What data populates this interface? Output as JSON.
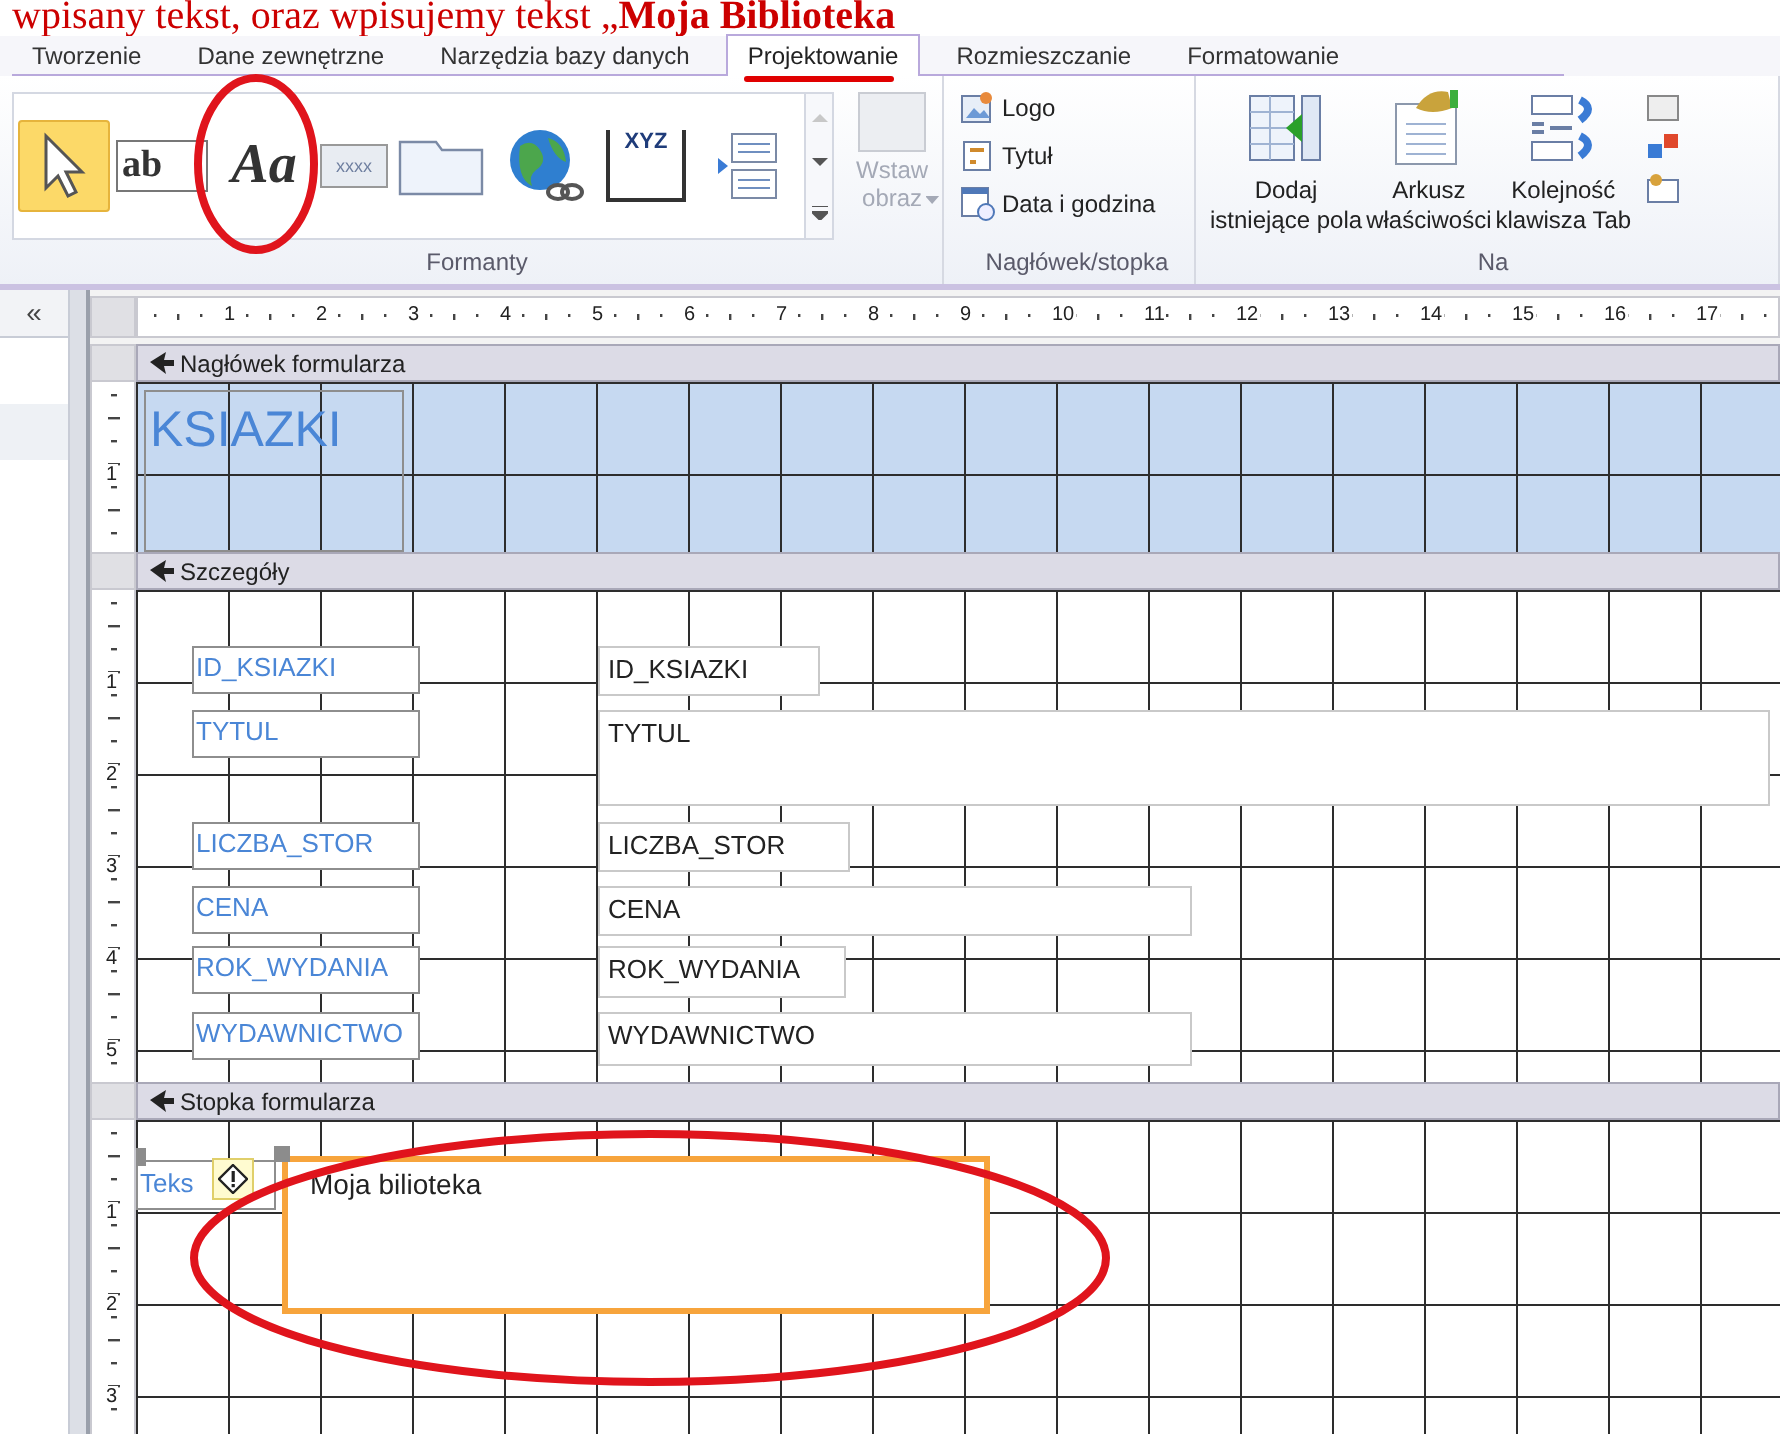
{
  "annotation": "wpisany tekst, oraz wpisujemy tekst „**Moja Biblioteka**",
  "tabs": [
    {
      "label": "Tworzenie",
      "selected": false
    },
    {
      "label": "Dane zewnętrzne",
      "selected": false
    },
    {
      "label": "Narzędzia bazy danych",
      "selected": false
    },
    {
      "label": "Projektowanie",
      "selected": true
    },
    {
      "label": "Rozmieszczanie",
      "selected": false
    },
    {
      "label": "Formatowanie",
      "selected": false
    }
  ],
  "ribbon": {
    "controls_group": {
      "label": "Formanty",
      "gallery": [
        {
          "kind": "pointer",
          "selected": true
        },
        {
          "kind": "textbox",
          "text": "ab"
        },
        {
          "kind": "label",
          "text": "Aa"
        },
        {
          "kind": "button",
          "text": "xxxx"
        },
        {
          "kind": "tab"
        },
        {
          "kind": "hyperlink"
        },
        {
          "kind": "option-group",
          "text": "XYZ"
        },
        {
          "kind": "list"
        }
      ],
      "insert_image": {
        "label": "Wstaw obraz",
        "disabled": true
      }
    },
    "header_group": {
      "label": "Nagłówek/stopka",
      "items": [
        {
          "kind": "logo",
          "label": "Logo"
        },
        {
          "kind": "title",
          "label": "Tytuł"
        },
        {
          "kind": "date",
          "label": "Data i godzina"
        }
      ]
    },
    "tools_group": {
      "label": "Na",
      "items": [
        {
          "kind": "fields",
          "line_1": "Dodaj",
          "line_2": "istniejące pola"
        },
        {
          "kind": "sheet",
          "line_1": "Arkusz",
          "line_2": "właściwości"
        },
        {
          "kind": "order",
          "line_1": "Kolejność",
          "line_2": "klawisza Tab"
        }
      ]
    }
  },
  "nav_pane": {
    "toggle": "«"
  },
  "ruler": {
    "marks": [
      "1",
      "2",
      "3",
      "4",
      "5",
      "6",
      "7",
      "8",
      "9",
      "10",
      "11",
      "12",
      "13",
      "14",
      "15",
      "16",
      "17"
    ]
  },
  "sections": [
    {
      "kind": "header",
      "title": "Nagłówek formularza",
      "ruler_marks": [
        "1"
      ],
      "controls": [
        {
          "kind": "title",
          "text": "KSIAZKI"
        }
      ]
    },
    {
      "kind": "detail",
      "title": "Szczegóły",
      "ruler_marks": [
        "1",
        "2",
        "3",
        "4",
        "5"
      ],
      "controls": [
        {
          "kind": "field",
          "label": "ID_KSIAZKI",
          "value": "ID_KSIAZKI"
        },
        {
          "kind": "field",
          "label": "TYTUL",
          "value": "TYTUL"
        },
        {
          "kind": "field",
          "label": "LICZBA_STOR",
          "value": "LICZBA_STOR"
        },
        {
          "kind": "field",
          "label": "CENA",
          "value": "CENA"
        },
        {
          "kind": "field",
          "label": "ROK_WYDANIA",
          "value": "ROK_WYDANIA"
        },
        {
          "kind": "field",
          "label": "WYDAWNICTWO",
          "value": "WYDAWNICTWO"
        }
      ]
    },
    {
      "kind": "footer",
      "title": "Stopka formularza",
      "ruler_marks": [
        "1",
        "2",
        "3"
      ],
      "controls": [
        {
          "kind": "field",
          "label": "Teks",
          "value": "Moja bilioteka",
          "selected": true,
          "warning": true
        }
      ]
    }
  ]
}
